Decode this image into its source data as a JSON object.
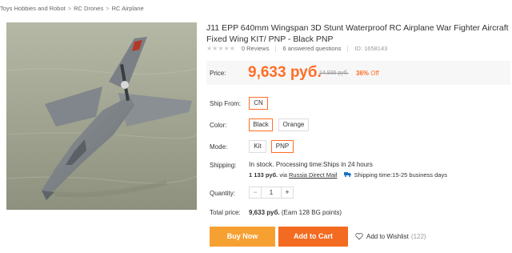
{
  "breadcrumb": {
    "items": [
      "Toys Hobbies and Robot",
      "RC Drones",
      "RC Airplane"
    ],
    "separator": ">"
  },
  "product": {
    "title": "J11 EPP 640mm Wingspan 3D Stunt Waterproof RC Airplane War Fighter Aircraft Fixed Wing KIT/ PNP - Black PNP",
    "reviews": "0 Reviews",
    "questions": "6 answered questions",
    "id_label": "ID: 1658143",
    "rating": 0,
    "max_rating": 5
  },
  "price": {
    "label": "Price:",
    "current": "9,633 руб.",
    "original": "14,936 руб.",
    "discount_pct": "36%",
    "discount_word": "Off"
  },
  "ship_from": {
    "label": "Ship From:",
    "options": [
      "CN"
    ],
    "selected": "CN"
  },
  "color": {
    "label": "Color:",
    "options": [
      "Black",
      "Orange"
    ],
    "selected": "Black"
  },
  "mode": {
    "label": "Mode:",
    "options": [
      "Kit",
      "PNP"
    ],
    "selected": "PNP"
  },
  "shipping": {
    "label": "Shipping:",
    "stock": "In stock.",
    "processing": "Processing time:Ships in 24 hours",
    "cost": "1 133 руб.",
    "via": "via",
    "method": "Russia Direct Mail",
    "time": "Shipping time:15-25 business days"
  },
  "quantity": {
    "label": "Quantity:",
    "value": "1",
    "minus": "−",
    "plus": "+"
  },
  "total": {
    "label": "Total price:",
    "value": "9,633 руб.",
    "points": "(Earn 128 BG points)"
  },
  "actions": {
    "buy_now": "Buy Now",
    "add_to_cart": "Add to Cart",
    "wishlist": "Add to Wishlist",
    "wishlist_count": "(122)"
  },
  "colors": {
    "accent": "#ff6e26",
    "buy_button": "#f7a032",
    "cart_button": "#f36b21"
  },
  "icons": {
    "star": "star-icon",
    "truck": "truck-icon",
    "heart": "heart-icon"
  }
}
